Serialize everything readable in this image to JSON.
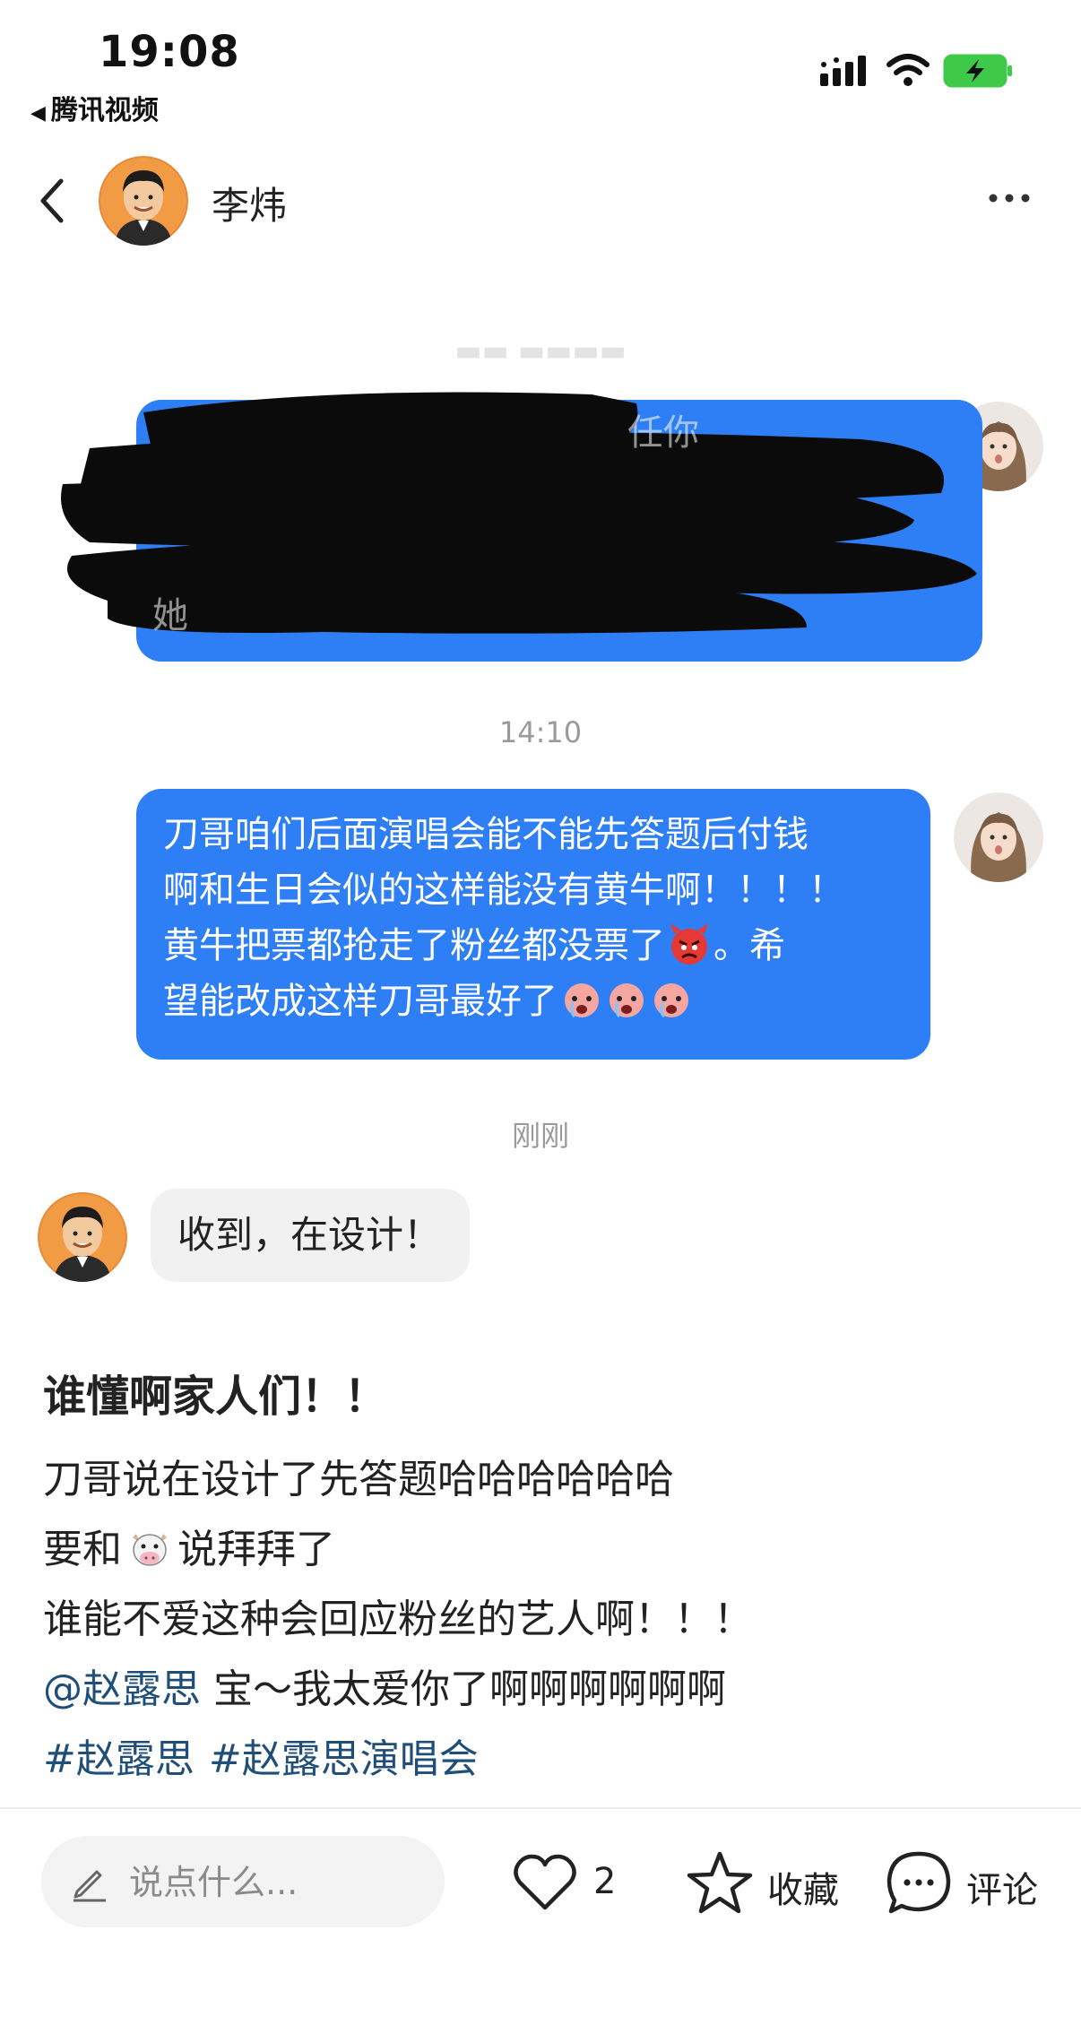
{
  "status_bar": {
    "time": "19:08",
    "back_app": "腾讯视频",
    "icons": [
      "signal-icon",
      "wifi-icon",
      "battery-charging-icon"
    ]
  },
  "header": {
    "contact_name": "李炜",
    "icons": [
      "back-chevron-icon",
      "more-dots-icon"
    ]
  },
  "chat": {
    "redacted_message": {
      "visible_fragments": [
        "任你",
        "她"
      ]
    },
    "timestamp_1": "14:10",
    "message_2": {
      "lines": [
        "刀哥咱们后面演唱会能不能先答题后付钱",
        "啊和生日会似的这样能没有黄牛啊！！！！",
        "黄牛把票都抢走了粉丝都没票了",
        "望能改成这样刀哥最好了"
      ],
      "line3_tail": "。希",
      "emojis": [
        "angry-devil-emoji",
        "crying-emoji",
        "crying-emoji",
        "crying-emoji"
      ]
    },
    "timestamp_2": "刚刚",
    "reply": {
      "text": "收到，在设计！"
    }
  },
  "post": {
    "title": "谁懂啊家人们！！",
    "line1": "刀哥说在设计了先答题哈哈哈哈哈哈",
    "line2_prefix": "要和",
    "line2_suffix": "说拜拜了",
    "line3": "谁能不爱这种会回应粉丝的艺人啊！！！",
    "mention": "@赵露思",
    "line4_rest": " 宝～我太爱你了啊啊啊啊啊啊",
    "hashtags": [
      "#赵露思",
      "#赵露思演唱会"
    ]
  },
  "bottom_bar": {
    "comment_placeholder": "说点什么...",
    "like_count": "2",
    "favorite_label": "收藏",
    "comment_label": "评论"
  },
  "colors": {
    "bubble_blue": "#2e7ff5",
    "link_blue": "#1f4e79",
    "timestamp_gray": "#9a9a9a",
    "battery_green": "#3ec94a"
  }
}
